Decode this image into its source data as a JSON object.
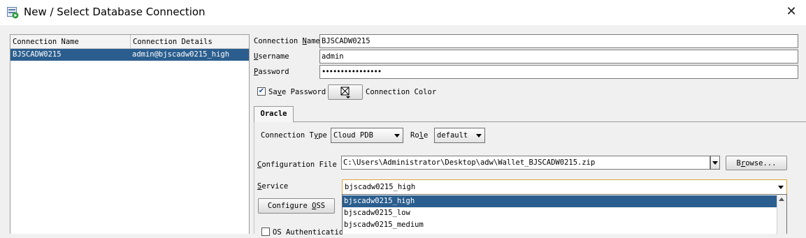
{
  "window": {
    "title": "New / Select Database Connection",
    "close_glyph": "✕"
  },
  "connection_list": {
    "columns": [
      "Connection Name",
      "Connection Details"
    ],
    "rows": [
      {
        "name": "BJSCADW0215",
        "details": "admin@bjscadw0215_high",
        "selected": true
      }
    ]
  },
  "form": {
    "connection_name": {
      "label_pre": "Connection ",
      "label_key": "N",
      "label_post": "ame",
      "value": "BJSCADW0215"
    },
    "username": {
      "label_key": "U",
      "label_post": "sername",
      "value": "admin"
    },
    "password": {
      "label_key": "P",
      "label_post": "assword",
      "value": "••••••••••••••••"
    },
    "save_password": {
      "label_pre": "Sa",
      "label_key": "v",
      "label_post": "e Password",
      "checked": true,
      "check_glyph": "✔"
    },
    "connection_color": {
      "label": "Connection Color",
      "button_icon": "color-picker-icon"
    }
  },
  "tabs": [
    {
      "label": "Oracle",
      "active": true
    }
  ],
  "oracle": {
    "connection_type": {
      "label_pre": "Connection T",
      "label_key": "y",
      "label_post": "pe",
      "value": "Cloud PDB"
    },
    "role": {
      "label_pre": "Ro",
      "label_key": "l",
      "label_post": "e",
      "value": "default"
    },
    "config_file": {
      "label_pre": "",
      "label_key": "C",
      "label_post": "onfiguration File",
      "value": "C:\\Users\\Administrator\\Desktop\\adw\\Wallet_BJSCADW0215.zip"
    },
    "browse_button": {
      "label_pre": "B",
      "label_key": "r",
      "label_post": "owse..."
    },
    "service": {
      "label_pre": "",
      "label_key": "S",
      "label_post": "ervice",
      "value": "bjscadw0215_high"
    },
    "configure_oss_button": {
      "label_pre": "Configure ",
      "label_key": "O",
      "label_post": "SS"
    },
    "os_auth": {
      "label": "OS Authenticatio",
      "checked": false
    },
    "service_options": [
      "bjscadw0215_high",
      "bjscadw0215_low",
      "bjscadw0215_medium"
    ],
    "selected_option_index": 0
  },
  "colors": {
    "selection": "#2b5e8e",
    "titlebar": "#ffffff",
    "background": "#f0f0f0"
  }
}
